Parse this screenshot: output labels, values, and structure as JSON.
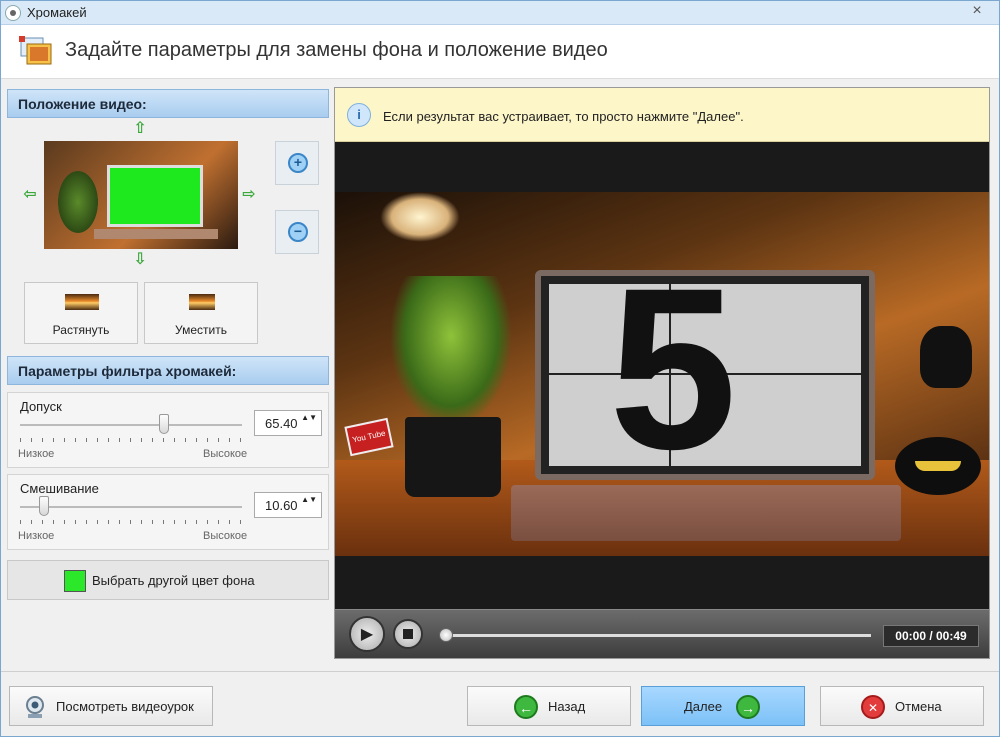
{
  "window": {
    "title": "Хромакей",
    "close_glyph": "×"
  },
  "header": {
    "title": "Задайте параметры для замены фона и положение видео",
    "icon": "image-layers-icon"
  },
  "position": {
    "heading": "Положение видео:",
    "arrow_up": "⇧",
    "arrow_down": "⇩",
    "arrow_left": "⇦",
    "arrow_right": "⇨",
    "zoom_in": "+",
    "zoom_out": "−",
    "stretch_label": "Растянуть",
    "fit_label": "Уместить"
  },
  "filter": {
    "heading": "Параметры фильтра хромакей:",
    "tolerance": {
      "label": "Допуск",
      "value": "65.40",
      "level": 0.65,
      "low": "Низкое",
      "high": "Высокое"
    },
    "blending": {
      "label": "Смешивание",
      "value": "10.60",
      "level": 0.11,
      "low": "Низкое",
      "high": "Высокое"
    },
    "spin_glyph": "▲▼"
  },
  "bg_color": {
    "label": "Выбрать другой цвет фона",
    "color": "#2be82b"
  },
  "info": {
    "icon": "i",
    "text": "Если результат вас устраивает, то просто нажмите \"Далее\"."
  },
  "preview": {
    "countdown": "5",
    "badge": "You Tube"
  },
  "player": {
    "play_glyph": "▶",
    "time": "00:00 / 00:49",
    "progress": 0.0
  },
  "footer": {
    "tutorial_label": "Посмотреть видеоурок",
    "back_label": "Назад",
    "next_label": "Далее",
    "cancel_label": "Отмена",
    "back_glyph": "←",
    "next_glyph": "→",
    "cancel_glyph": "✕"
  },
  "colors": {
    "accent": "#7cc1f7",
    "chroma_green": "#2be82b",
    "info_bg": "#fdf6c9"
  }
}
